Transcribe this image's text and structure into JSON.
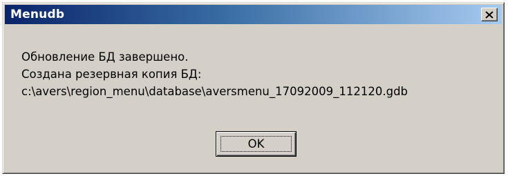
{
  "window": {
    "title": "Menudb"
  },
  "titlebar": {
    "close_icon": "close-icon",
    "gradient_start": "#0a246a",
    "gradient_end": "#a6caf0"
  },
  "message": {
    "line1": "Обновление БД завершено.",
    "line2": "Создана резервная копия БД:",
    "line3": "c:\\avers\\region_menu\\database\\aversmenu_17092009_112120.gdb"
  },
  "buttons": {
    "ok_label": "OK"
  },
  "colors": {
    "dialog_bg": "#d4d0c8",
    "title_text": "#ffffff",
    "text": "#000000"
  }
}
